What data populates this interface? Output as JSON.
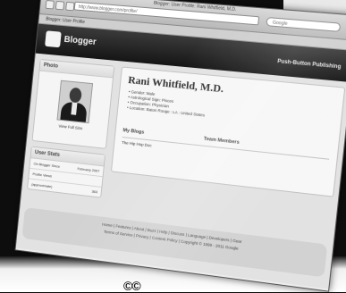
{
  "window": {
    "title": "Blogger: User Profile: Rani Whitfield, M.D."
  },
  "browser": {
    "url": "http://www.blogger.com/profile/",
    "search_placeholder": "Google",
    "tab_label": "Blogger: User Profile"
  },
  "header": {
    "logo_text": "Blogger",
    "tagline": "Push-Button Publishing"
  },
  "sidebar": {
    "photo_heading": "Photo",
    "photo_link": "View Full Size",
    "stats_heading": "User Stats",
    "stats": [
      {
        "label": "On Blogger Since",
        "value": "February 2007"
      },
      {
        "label": "Profile Views",
        "value": ""
      },
      {
        "label": "(approximate)",
        "value": "363"
      }
    ]
  },
  "profile": {
    "name": "Rani Whitfield, M.D.",
    "facts": [
      "• Gender: Male",
      "• Astrological Sign: Pisces",
      "• Occupation: Physician",
      "• Location: Baton Rouge : LA : United States"
    ],
    "blogs_heading": "My Blogs",
    "team_heading": "Team Members",
    "blog_item": "The Hip Hop Doc"
  },
  "footer": {
    "line1": "Home | Features | About | Buzz | Help | Discuss | Language | Developers | Gear",
    "line2": "Terms of Service | Privacy | Content Policy | Copyright © 1999 - 2011 Google"
  },
  "overlay": {
    "bottom_mark": "©©"
  }
}
